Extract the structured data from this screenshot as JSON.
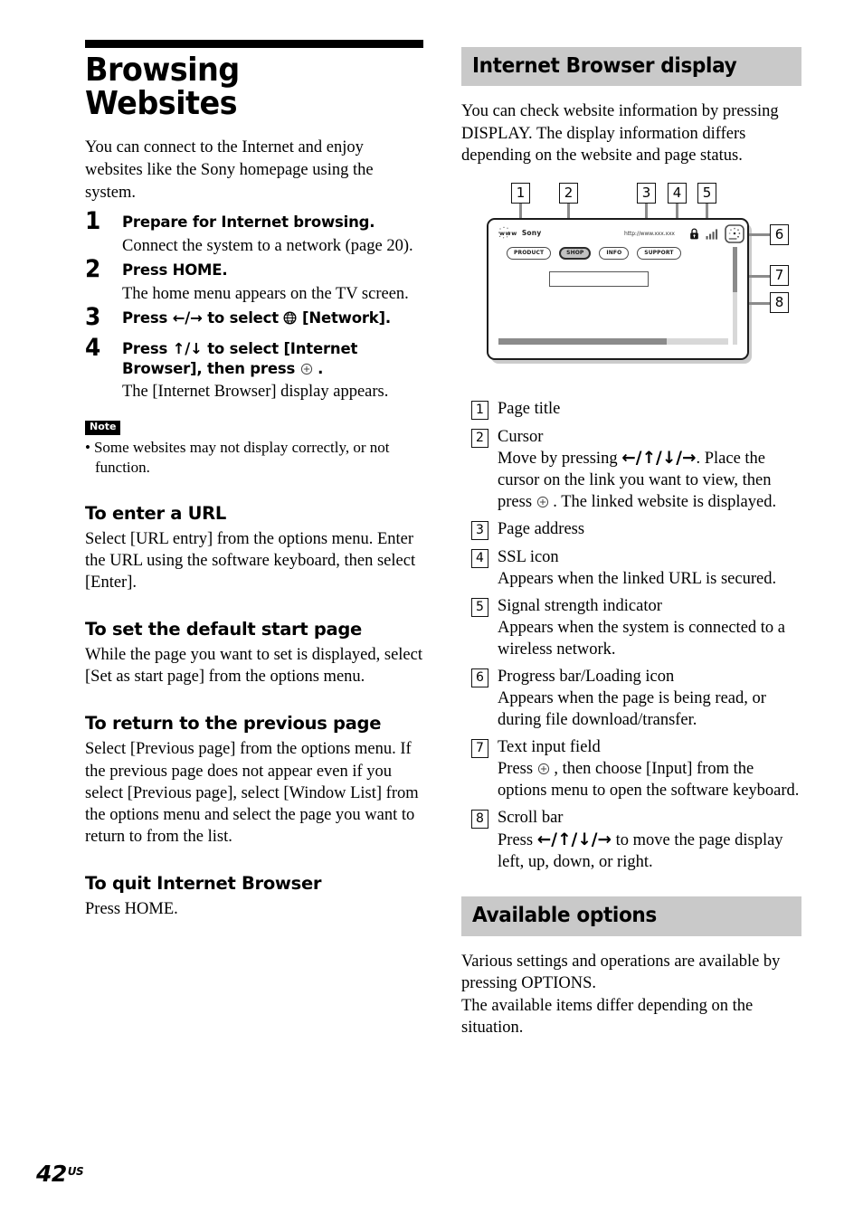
{
  "left": {
    "title": "Browsing Websites",
    "intro": "You can connect to the Internet and enjoy websites like the Sony homepage using the system.",
    "steps": [
      {
        "num": "1",
        "head": "Prepare for Internet browsing.",
        "body": "Connect the system to a network (page 20)."
      },
      {
        "num": "2",
        "head": "Press HOME.",
        "body": "The home menu appears on the TV screen."
      },
      {
        "num": "3",
        "head_pre": "Press ",
        "head_arrows": "←/→",
        "head_mid": " to select ",
        "head_icon": "globe-icon",
        "head_post": " [Network].",
        "body": ""
      },
      {
        "num": "4",
        "head_pre": "Press ",
        "head_arrows": "↑/↓",
        "head_mid": " to select [Internet Browser], then press ",
        "head_icon": "enter-icon",
        "head_post": " .",
        "body": "The [Internet Browser] display appears."
      }
    ],
    "note": {
      "badge": "Note",
      "bullet": "•",
      "text": "Some websites may not display correctly, or not function."
    },
    "sections": [
      {
        "head": "To enter a URL",
        "body": "Select [URL entry] from the options menu. Enter the URL using the software keyboard, then select [Enter]."
      },
      {
        "head": "To set the default start page",
        "body": "While the page you want to set is displayed, select [Set as start page] from the options menu."
      },
      {
        "head": "To return to the previous page",
        "body": "Select [Previous page] from the options menu. If the previous page does not appear even if you select [Previous page], select [Window List] from the options menu and select the page you want to return to from the list."
      },
      {
        "head": "To quit Internet Browser",
        "body": "Press HOME."
      }
    ]
  },
  "right": {
    "section1": {
      "title": "Internet Browser display",
      "body": "You can check website information by pressing DISPLAY. The display information differs depending on the website and page status."
    },
    "diagram": {
      "callouts": [
        "1",
        "2",
        "3",
        "4",
        "5",
        "6",
        "7",
        "8"
      ],
      "screen": {
        "logo_www": "www",
        "logo_brand": "Sony",
        "url": "http://www.xxx.xxx",
        "lock_icon": "lock-icon",
        "signal_icon": "signal-bars-icon",
        "loading_icon": "loading-spinner-icon",
        "nav_buttons": [
          "PRODUCT",
          "SHOP",
          "INFO",
          "SUPPORT"
        ],
        "nav_selected": "SHOP",
        "progress_percent": 73,
        "scroll_thumb_percent": 46
      }
    },
    "legend": [
      {
        "num": "1",
        "title": "Page title",
        "desc": ""
      },
      {
        "num": "2",
        "title": "Cursor",
        "desc_pre": "Move by pressing ",
        "desc_arrows": "←/↑/↓/→",
        "desc_mid": ". Place the cursor on the link you want to view, then press ",
        "desc_icon": "enter-icon",
        "desc_post": " . The linked website is displayed."
      },
      {
        "num": "3",
        "title": "Page address",
        "desc": ""
      },
      {
        "num": "4",
        "title": "SSL icon",
        "desc": "Appears when the linked URL is secured."
      },
      {
        "num": "5",
        "title": "Signal strength indicator",
        "desc": "Appears when the system is connected to a wireless network."
      },
      {
        "num": "6",
        "title": "Progress bar/Loading icon",
        "desc": "Appears when the page is being read, or during file download/transfer."
      },
      {
        "num": "7",
        "title": "Text input field",
        "desc_pre": "Press ",
        "desc_icon": "enter-icon",
        "desc_post": " , then choose [Input] from the options menu to open the software keyboard."
      },
      {
        "num": "8",
        "title": "Scroll bar",
        "desc_pre": "Press ",
        "desc_arrows": "←/↑/↓/→",
        "desc_post": " to move the page display left, up, down, or right."
      }
    ],
    "section2": {
      "title": "Available options",
      "body_line1": "Various settings and operations are available by pressing OPTIONS.",
      "body_line2": "The available items differ depending on the situation."
    }
  },
  "footer": {
    "page_number": "42",
    "region": "US"
  },
  "colors": {
    "band": "#c9c9c9",
    "leader": "#8b8b8b",
    "cursor_fill": "#c2c2c2"
  }
}
